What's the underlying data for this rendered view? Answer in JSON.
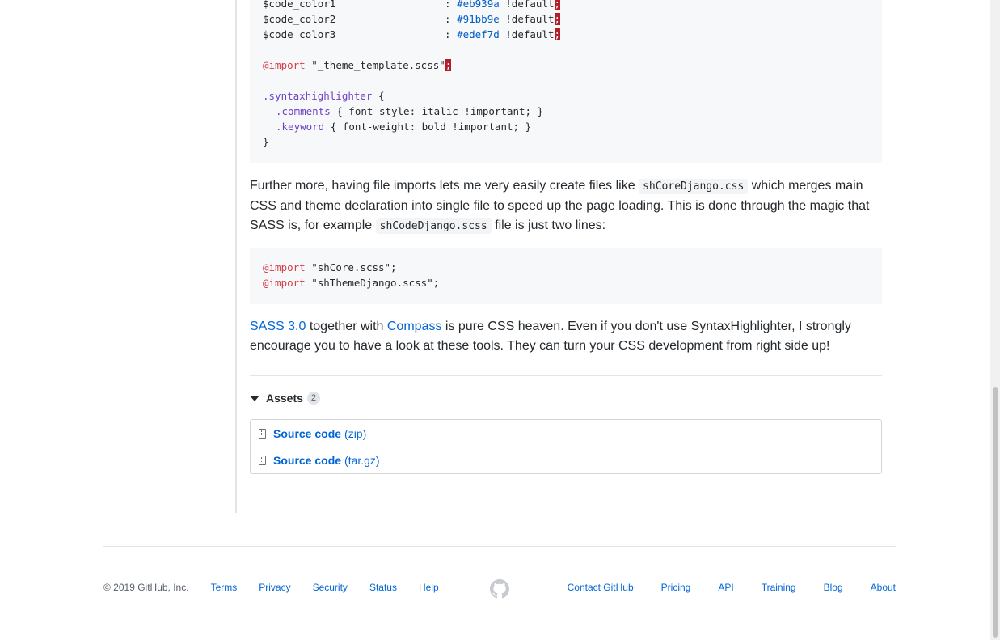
{
  "code_block_1": {
    "lines": [
      {
        "var": "$code_color1",
        "colon": ":",
        "value": "#eb939a",
        "flag": "!default",
        "semi": ";"
      },
      {
        "var": "$code_color2",
        "colon": ":",
        "value": "#91bb9e",
        "flag": "!default",
        "semi": ";"
      },
      {
        "var": "$code_color3",
        "colon": ":",
        "value": "#edef7d",
        "flag": "!default",
        "semi": ";"
      }
    ],
    "import_kw": "@import",
    "import_str": "\"_theme_template.scss\"",
    "import_semi": ";",
    "selector": ".syntaxhighlighter",
    "open_brace": " {",
    "rule1_sel": ".comments",
    "rule1_body": " { font-style: italic !important; }",
    "rule2_sel": ".keyword",
    "rule2_body": " { font-weight: bold !important; }",
    "close_brace": "}"
  },
  "para1": {
    "t1": "Further more, having file imports lets me very easily create files like ",
    "code1": "shCoreDjango.css",
    "t2": " which merges main CSS and theme declaration into single file to speed up the page loading. This is done through the magic that SASS is, for example ",
    "code2": "shCodeDjango.scss",
    "t3": " file is just two lines:"
  },
  "code_block_2": {
    "line1_kw": "@import",
    "line1_rest": " \"shCore.scss\";",
    "line2_kw": "@import",
    "line2_rest": " \"shThemeDjango.scss\";"
  },
  "para2": {
    "link1": "SASS 3.0",
    "t1": " together with ",
    "link2": "Compass",
    "t2": " is pure CSS heaven. Even if you don't use SyntaxHighlighter, I strongly encourage you to have a look at these tools. They can turn your CSS development from right side up!"
  },
  "assets": {
    "label": "Assets",
    "count": "2",
    "items": [
      {
        "name": "Source code",
        "type": "(zip)"
      },
      {
        "name": "Source code",
        "type": "(tar.gz)"
      }
    ]
  },
  "footer": {
    "copyright": "© 2019 GitHub, Inc.",
    "left_links": [
      "Terms",
      "Privacy",
      "Security",
      "Status",
      "Help"
    ],
    "right_links": [
      "Contact GitHub",
      "Pricing",
      "API",
      "Training",
      "Blog",
      "About"
    ]
  },
  "colors": {
    "link": "#0366d6",
    "keyword": "#d73a49",
    "class": "#6f42c1",
    "number": "#005cc5"
  },
  "icons": [
    "triangle-down-icon",
    "file-zip-icon",
    "github-mark-icon"
  ]
}
